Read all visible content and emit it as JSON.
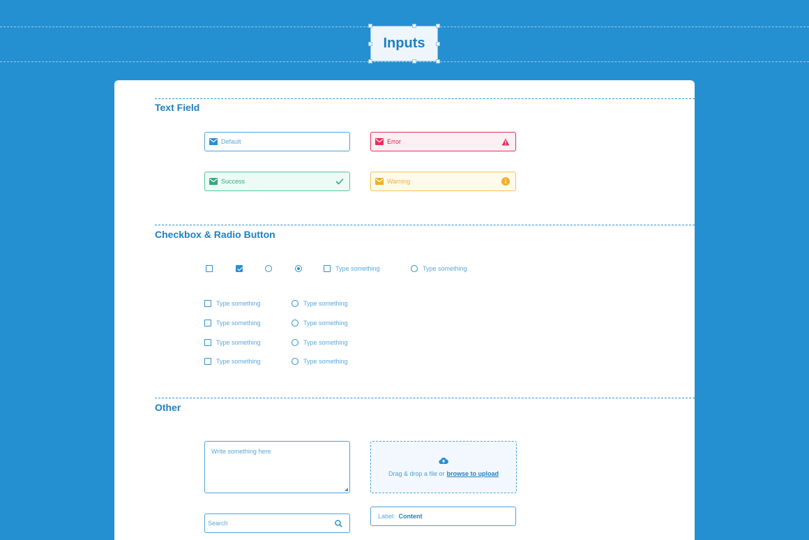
{
  "header": {
    "title": "Inputs"
  },
  "sections": {
    "text_field": "Text Field",
    "checkbox_radio": "Checkbox & Radio Button",
    "other": "Other"
  },
  "text_fields": {
    "default": {
      "placeholder": "Default",
      "icon": "mail-icon"
    },
    "error": {
      "placeholder": "Error",
      "icon": "mail-icon",
      "status_icon": "alert-triangle-icon"
    },
    "success": {
      "placeholder": "Success",
      "icon": "mail-icon",
      "status_icon": "check-icon"
    },
    "warning": {
      "placeholder": "Warning",
      "icon": "mail-icon",
      "status_icon": "info-circle-icon"
    }
  },
  "checkbox_radio": {
    "row": {
      "checkbox_unchecked": false,
      "checkbox_checked": true,
      "radio_unchecked": false,
      "radio_checked": true,
      "checkbox_label": "Type something",
      "radio_label": "Type something"
    },
    "checkbox_list": [
      "Type something",
      "Type something",
      "Type something",
      "Type something"
    ],
    "radio_list": [
      "Type something",
      "Type something",
      "Type something",
      "Type something"
    ]
  },
  "other": {
    "textarea_placeholder": "Write something here",
    "upload": {
      "text": "Drag & drop a file or",
      "link": "browse to upload",
      "icon": "cloud-upload-icon"
    },
    "search_placeholder": "Search",
    "labeled": {
      "label": "Label:",
      "value": "Content"
    }
  },
  "colors": {
    "background": "#2490d1",
    "primary": "#1f7fc0",
    "error": "#e2315d",
    "success": "#2eaa82",
    "warning": "#f0b02a"
  }
}
